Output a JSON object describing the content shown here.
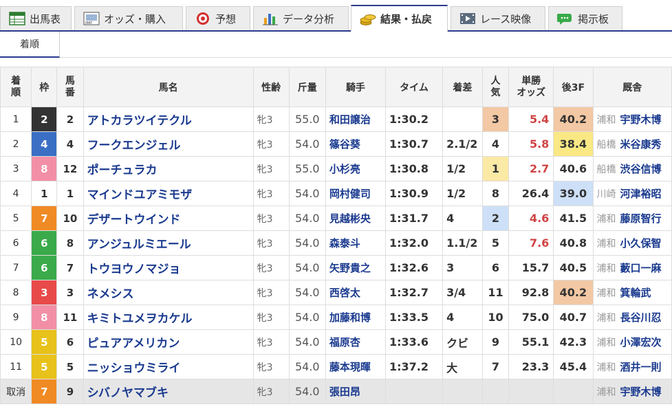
{
  "tabs": [
    {
      "label": "出馬表",
      "icon": "table-icon"
    },
    {
      "label": "オッズ・購入",
      "icon": "ipat-icon"
    },
    {
      "label": "予想",
      "icon": "target-icon"
    },
    {
      "label": "データ分析",
      "icon": "bar-chart-icon"
    },
    {
      "label": "結果・払戻",
      "icon": "coins-icon"
    },
    {
      "label": "レース映像",
      "icon": "film-icon"
    },
    {
      "label": "掲示板",
      "icon": "speech-bubble-icon"
    }
  ],
  "tab_icon_text": {
    "ipat": "IPAT"
  },
  "subtab": "着順",
  "columns": {
    "rank_1": "着",
    "rank_2": "順",
    "waku": "枠",
    "num_1": "馬",
    "num_2": "番",
    "name": "馬名",
    "sexage": "性齢",
    "weight": "斤量",
    "jockey": "騎手",
    "time": "タイム",
    "margin": "着差",
    "pop_1": "人",
    "pop_2": "気",
    "odds_1": "単勝",
    "odds_2": "オッズ",
    "last3f": "後3F",
    "trainer": "厩舎"
  },
  "colors": {
    "waku": {
      "1": "#ffffff",
      "2": "#333333",
      "3": "#e84a4a",
      "4": "#3a6fc4",
      "5": "#e8c21a",
      "6": "#3aaa4a",
      "7": "#f08a24",
      "8": "#f28fa6"
    },
    "pop1": "#fbe9a6",
    "pop2": "#cde0f7",
    "pop3": "#f3c8a4",
    "f3_1": "#f9e884",
    "f3_2": "#cde0f7",
    "f3_3": "#f3c8a4"
  },
  "rows": [
    {
      "rank": "1",
      "waku": "2",
      "num": "2",
      "name": "アトカラツイテクル",
      "sex": "牝3",
      "wt": "55.0",
      "jockey": "和田譲治",
      "time": "1:30.2",
      "margin": "",
      "pop": "3",
      "odds": "5.4",
      "f3": "40.2",
      "loc": "浦和",
      "trainer": "宇野木博"
    },
    {
      "rank": "2",
      "waku": "4",
      "num": "4",
      "name": "フークエンジェル",
      "sex": "牝3",
      "wt": "54.0",
      "jockey": "篠谷葵",
      "time": "1:30.7",
      "margin": "2.1/2",
      "pop": "4",
      "odds": "5.8",
      "f3": "38.4",
      "loc": "船橋",
      "trainer": "米谷康秀"
    },
    {
      "rank": "3",
      "waku": "8",
      "num": "12",
      "name": "ポーチュラカ",
      "sex": "牝3",
      "wt": "55.0",
      "jockey": "小杉亮",
      "time": "1:30.8",
      "margin": "1/2",
      "pop": "1",
      "odds": "2.7",
      "f3": "40.6",
      "loc": "船橋",
      "trainer": "渋谷信博"
    },
    {
      "rank": "4",
      "waku": "1",
      "num": "1",
      "name": "マインドユアミモザ",
      "sex": "牝3",
      "wt": "54.0",
      "jockey": "岡村健司",
      "time": "1:30.9",
      "margin": "1/2",
      "pop": "8",
      "odds": "26.4",
      "f3": "39.0",
      "loc": "川崎",
      "trainer": "河津裕昭"
    },
    {
      "rank": "5",
      "waku": "7",
      "num": "10",
      "name": "デザートウインド",
      "sex": "牝3",
      "wt": "54.0",
      "jockey": "見越彬央",
      "time": "1:31.7",
      "margin": "4",
      "pop": "2",
      "odds": "4.6",
      "f3": "41.5",
      "loc": "浦和",
      "trainer": "藤原智行"
    },
    {
      "rank": "6",
      "waku": "6",
      "num": "8",
      "name": "アンジュルミエール",
      "sex": "牝3",
      "wt": "54.0",
      "jockey": "森泰斗",
      "time": "1:32.0",
      "margin": "1.1/2",
      "pop": "5",
      "odds": "7.6",
      "f3": "40.8",
      "loc": "浦和",
      "trainer": "小久保智"
    },
    {
      "rank": "7",
      "waku": "6",
      "num": "7",
      "name": "トウヨウノマジョ",
      "sex": "牝3",
      "wt": "54.0",
      "jockey": "矢野貴之",
      "time": "1:32.6",
      "margin": "3",
      "pop": "6",
      "odds": "15.7",
      "f3": "40.5",
      "loc": "浦和",
      "trainer": "藪口一麻"
    },
    {
      "rank": "8",
      "waku": "3",
      "num": "3",
      "name": "ネメシス",
      "sex": "牝3",
      "wt": "54.0",
      "jockey": "西啓太",
      "time": "1:32.7",
      "margin": "3/4",
      "pop": "11",
      "odds": "92.8",
      "f3": "40.2",
      "loc": "浦和",
      "trainer": "箕輪武"
    },
    {
      "rank": "9",
      "waku": "8",
      "num": "11",
      "name": "キミトユメヲカケル",
      "sex": "牝3",
      "wt": "54.0",
      "jockey": "加藤和博",
      "time": "1:33.5",
      "margin": "4",
      "pop": "10",
      "odds": "75.0",
      "f3": "40.7",
      "loc": "浦和",
      "trainer": "長谷川忍"
    },
    {
      "rank": "10",
      "waku": "5",
      "num": "6",
      "name": "ピュアアメリカン",
      "sex": "牝3",
      "wt": "54.0",
      "jockey": "福原杏",
      "time": "1:33.6",
      "margin": "クビ",
      "pop": "9",
      "odds": "55.1",
      "f3": "42.3",
      "loc": "浦和",
      "trainer": "小澤宏次"
    },
    {
      "rank": "11",
      "waku": "5",
      "num": "5",
      "name": "ニッショウミライ",
      "sex": "牝3",
      "wt": "54.0",
      "jockey": "藤本現暉",
      "time": "1:37.2",
      "margin": "大",
      "pop": "7",
      "odds": "23.3",
      "f3": "45.4",
      "loc": "浦和",
      "trainer": "酒井一則"
    },
    {
      "rank": "取消",
      "waku": "7",
      "num": "9",
      "name": "シバノヤマブキ",
      "sex": "牝3",
      "wt": "54.0",
      "jockey": "張田昂",
      "time": "",
      "margin": "",
      "pop": "",
      "odds": "",
      "f3": "",
      "loc": "浦和",
      "trainer": "宇野木博",
      "scratched": true
    }
  ]
}
